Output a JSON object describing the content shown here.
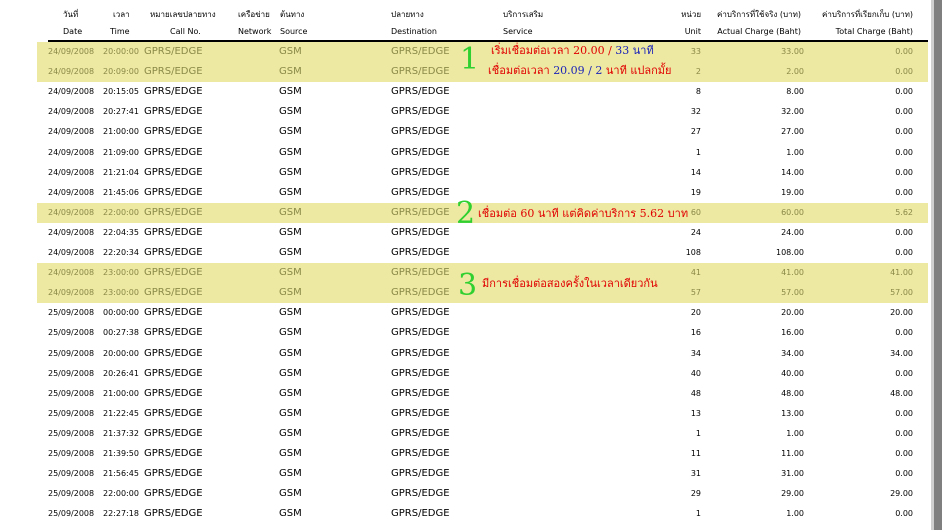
{
  "header": {
    "thai": {
      "date": "วันที่",
      "time": "เวลา",
      "call_no": "หมายเลขปลายทาง",
      "network": "เครือข่าย",
      "source": "ต้นทาง",
      "destination": "ปลายทาง",
      "service": "บริการเสริม",
      "unit": "หน่วย",
      "actual": "ค่าบริการที่ใช้จริง (บาท)",
      "total": "ค่าบริการที่เรียกเก็บ (บาท)"
    },
    "english": {
      "date": "Date",
      "time": "Time",
      "call_no": "Call No.",
      "network": "Network",
      "source": "Source",
      "destination": "Destination",
      "service": "Service",
      "unit": "Unit",
      "actual": "Actual Charge (Baht)",
      "total": "Total Charge (Baht)"
    }
  },
  "rows": [
    {
      "date": "24/09/2008",
      "time": "20:00:00",
      "call_no": "GPRS/EDGE",
      "source": "GSM",
      "destination": "GPRS/EDGE",
      "unit": "33",
      "actual": "33.00",
      "total": "0.00",
      "highlight": true
    },
    {
      "date": "24/09/2008",
      "time": "20:09:00",
      "call_no": "GPRS/EDGE",
      "source": "GSM",
      "destination": "GPRS/EDGE",
      "unit": "2",
      "actual": "2.00",
      "total": "0.00",
      "highlight": true
    },
    {
      "date": "24/09/2008",
      "time": "20:15:05",
      "call_no": "GPRS/EDGE",
      "source": "GSM",
      "destination": "GPRS/EDGE",
      "unit": "8",
      "actual": "8.00",
      "total": "0.00",
      "highlight": false
    },
    {
      "date": "24/09/2008",
      "time": "20:27:41",
      "call_no": "GPRS/EDGE",
      "source": "GSM",
      "destination": "GPRS/EDGE",
      "unit": "32",
      "actual": "32.00",
      "total": "0.00",
      "highlight": false
    },
    {
      "date": "24/09/2008",
      "time": "21:00:00",
      "call_no": "GPRS/EDGE",
      "source": "GSM",
      "destination": "GPRS/EDGE",
      "unit": "27",
      "actual": "27.00",
      "total": "0.00",
      "highlight": false
    },
    {
      "date": "24/09/2008",
      "time": "21:09:00",
      "call_no": "GPRS/EDGE",
      "source": "GSM",
      "destination": "GPRS/EDGE",
      "unit": "1",
      "actual": "1.00",
      "total": "0.00",
      "highlight": false
    },
    {
      "date": "24/09/2008",
      "time": "21:21:04",
      "call_no": "GPRS/EDGE",
      "source": "GSM",
      "destination": "GPRS/EDGE",
      "unit": "14",
      "actual": "14.00",
      "total": "0.00",
      "highlight": false
    },
    {
      "date": "24/09/2008",
      "time": "21:45:06",
      "call_no": "GPRS/EDGE",
      "source": "GSM",
      "destination": "GPRS/EDGE",
      "unit": "19",
      "actual": "19.00",
      "total": "0.00",
      "highlight": false
    },
    {
      "date": "24/09/2008",
      "time": "22:00:00",
      "call_no": "GPRS/EDGE",
      "source": "GSM",
      "destination": "GPRS/EDGE",
      "unit": "60",
      "actual": "60.00",
      "total": "5.62",
      "highlight": true
    },
    {
      "date": "24/09/2008",
      "time": "22:04:35",
      "call_no": "GPRS/EDGE",
      "source": "GSM",
      "destination": "GPRS/EDGE",
      "unit": "24",
      "actual": "24.00",
      "total": "0.00",
      "highlight": false
    },
    {
      "date": "24/09/2008",
      "time": "22:20:34",
      "call_no": "GPRS/EDGE",
      "source": "GSM",
      "destination": "GPRS/EDGE",
      "unit": "108",
      "actual": "108.00",
      "total": "0.00",
      "highlight": false
    },
    {
      "date": "24/09/2008",
      "time": "23:00:00",
      "call_no": "GPRS/EDGE",
      "source": "GSM",
      "destination": "GPRS/EDGE",
      "unit": "41",
      "actual": "41.00",
      "total": "41.00",
      "highlight": true
    },
    {
      "date": "24/09/2008",
      "time": "23:00:00",
      "call_no": "GPRS/EDGE",
      "source": "GSM",
      "destination": "GPRS/EDGE",
      "unit": "57",
      "actual": "57.00",
      "total": "57.00",
      "highlight": true
    },
    {
      "date": "25/09/2008",
      "time": "00:00:00",
      "call_no": "GPRS/EDGE",
      "source": "GSM",
      "destination": "GPRS/EDGE",
      "unit": "20",
      "actual": "20.00",
      "total": "20.00",
      "highlight": false
    },
    {
      "date": "25/09/2008",
      "time": "00:27:38",
      "call_no": "GPRS/EDGE",
      "source": "GSM",
      "destination": "GPRS/EDGE",
      "unit": "16",
      "actual": "16.00",
      "total": "0.00",
      "highlight": false
    },
    {
      "date": "25/09/2008",
      "time": "20:00:00",
      "call_no": "GPRS/EDGE",
      "source": "GSM",
      "destination": "GPRS/EDGE",
      "unit": "34",
      "actual": "34.00",
      "total": "34.00",
      "highlight": false
    },
    {
      "date": "25/09/2008",
      "time": "20:26:41",
      "call_no": "GPRS/EDGE",
      "source": "GSM",
      "destination": "GPRS/EDGE",
      "unit": "40",
      "actual": "40.00",
      "total": "0.00",
      "highlight": false
    },
    {
      "date": "25/09/2008",
      "time": "21:00:00",
      "call_no": "GPRS/EDGE",
      "source": "GSM",
      "destination": "GPRS/EDGE",
      "unit": "48",
      "actual": "48.00",
      "total": "48.00",
      "highlight": false
    },
    {
      "date": "25/09/2008",
      "time": "21:22:45",
      "call_no": "GPRS/EDGE",
      "source": "GSM",
      "destination": "GPRS/EDGE",
      "unit": "13",
      "actual": "13.00",
      "total": "0.00",
      "highlight": false
    },
    {
      "date": "25/09/2008",
      "time": "21:37:32",
      "call_no": "GPRS/EDGE",
      "source": "GSM",
      "destination": "GPRS/EDGE",
      "unit": "1",
      "actual": "1.00",
      "total": "0.00",
      "highlight": false
    },
    {
      "date": "25/09/2008",
      "time": "21:39:50",
      "call_no": "GPRS/EDGE",
      "source": "GSM",
      "destination": "GPRS/EDGE",
      "unit": "11",
      "actual": "11.00",
      "total": "0.00",
      "highlight": false
    },
    {
      "date": "25/09/2008",
      "time": "21:56:45",
      "call_no": "GPRS/EDGE",
      "source": "GSM",
      "destination": "GPRS/EDGE",
      "unit": "31",
      "actual": "31.00",
      "total": "0.00",
      "highlight": false
    },
    {
      "date": "25/09/2008",
      "time": "22:00:00",
      "call_no": "GPRS/EDGE",
      "source": "GSM",
      "destination": "GPRS/EDGE",
      "unit": "29",
      "actual": "29.00",
      "total": "29.00",
      "highlight": false
    },
    {
      "date": "25/09/2008",
      "time": "22:27:18",
      "call_no": "GPRS/EDGE",
      "source": "GSM",
      "destination": "GPRS/EDGE",
      "unit": "1",
      "actual": "1.00",
      "total": "0.00",
      "highlight": false
    }
  ],
  "annotations": {
    "note1": {
      "number": "1",
      "line1_a": "เริ่มเชื่อมต่อเวลา 20.00 / ",
      "line1_b": "33 นาที",
      "line2_a": "เชื่อมต่อเวลา ",
      "line2_b": "20.09 / 2",
      "line2_c": " นาที แปลกมั้ย"
    },
    "note2": {
      "number": "2",
      "text": "เชื่อมต่อ 60 นาที แต่คิดค่าบริการ 5.62 บาท"
    },
    "note3": {
      "number": "3",
      "text": "มีการเชื่อมต่อสองครั้งในเวลาเดียวกัน"
    }
  },
  "colors": {
    "highlight": "#ede8a2",
    "annotation_number": "#2fd02f",
    "annotation_text": "#e00000",
    "annotation_blue": "#1b24b8"
  }
}
